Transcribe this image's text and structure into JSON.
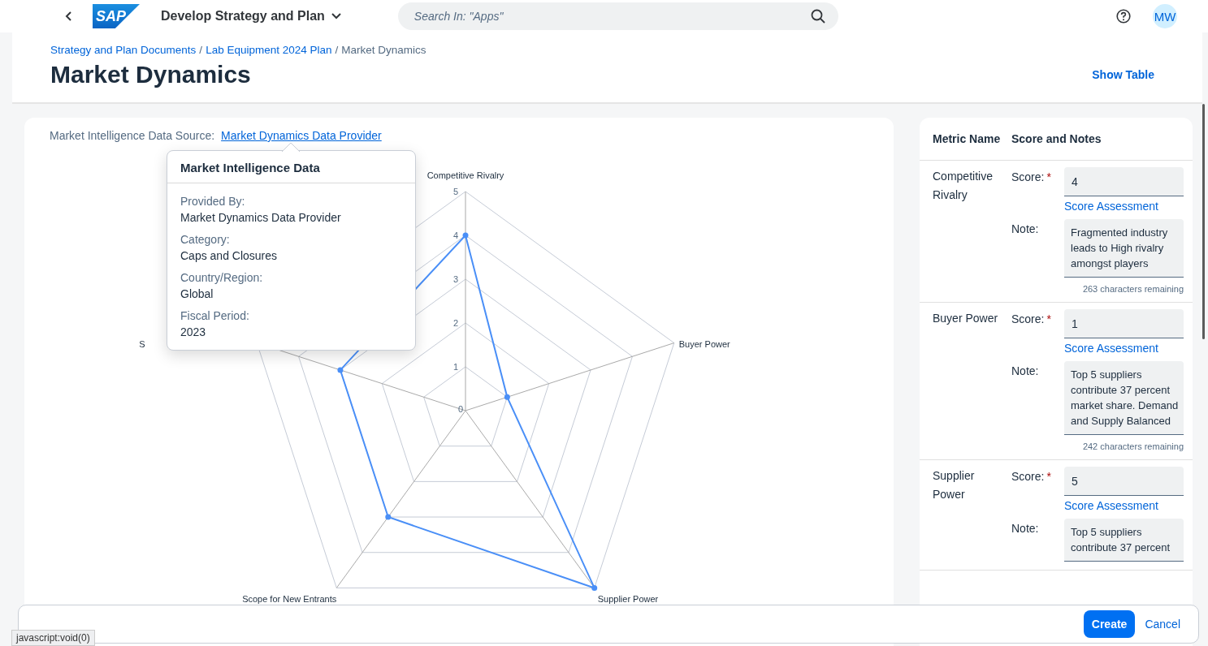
{
  "shell": {
    "logo": "SAP",
    "app_title": "Develop Strategy and Plan",
    "search": {
      "placeholder": "Search In: \"Apps\""
    },
    "avatar": "MW"
  },
  "breadcrumb_separator": "/",
  "breadcrumbs": [
    {
      "label": "Strategy and Plan Documents",
      "link": true
    },
    {
      "label": "Lab Equipment 2024 Plan",
      "link": true
    },
    {
      "label": "Market Dynamics",
      "link": false
    }
  ],
  "title": "Market Dynamics",
  "header_action": "Show Table",
  "source": {
    "label": "Market Intelligence Data Source:",
    "link": "Market Dynamics Data Provider"
  },
  "chart_data": {
    "type": "radar",
    "categories": [
      "Competitive Rivalry",
      "Buyer Power",
      "Supplier Power",
      "Scope for New Entrants",
      "S"
    ],
    "ylim": [
      0,
      5
    ],
    "yticks": [
      {
        "value": 0,
        "label": "0"
      },
      {
        "value": 1,
        "label": "1"
      },
      {
        "value": 2,
        "label": "2"
      },
      {
        "value": 3,
        "label": "3"
      },
      {
        "value": 4,
        "label": "4"
      },
      {
        "value": 5,
        "label": "5"
      }
    ],
    "series": [
      {
        "color": "#4a8ff7",
        "values": [
          4,
          1,
          5,
          3,
          3
        ]
      }
    ]
  },
  "popover": {
    "title": "Market Intelligence Data",
    "fields": [
      {
        "label": "Provided By:",
        "value": "Market Dynamics Data Provider"
      },
      {
        "label": "Category:",
        "value": "Caps and Closures"
      },
      {
        "label": "Country/Region:",
        "value": "Global"
      },
      {
        "label": "Fiscal Period:",
        "value": "2023"
      }
    ]
  },
  "metrics": {
    "required_marker": "*",
    "columns": [
      "Metric Name",
      "Score and Notes"
    ],
    "rows": [
      {
        "name": "Competitive Rivalry",
        "score_label": "Score:",
        "required": true,
        "score": "4",
        "link": "Score Assessment",
        "note_label": "Note:",
        "note": "Fragmented industry leads to High rivalry amongst players",
        "remaining": "263 characters remaining"
      },
      {
        "name": "Buyer Power",
        "score_label": "Score:",
        "required": true,
        "score": "1",
        "link": "Score Assessment",
        "note_label": "Note:",
        "note": "Top 5 suppliers contribute 37 percent market share. Demand and Supply Balanced",
        "remaining": "242 characters remaining"
      },
      {
        "name": "Supplier Power",
        "score_label": "Score:",
        "required": true,
        "score": "5",
        "link": "Score Assessment",
        "note_label": "Note:",
        "note": "Top 5 suppliers contribute 37 percent"
      }
    ]
  },
  "footer": {
    "buttons": [
      {
        "label": "Create",
        "kind": "primary"
      },
      {
        "label": "Cancel",
        "kind": "transparent"
      }
    ]
  },
  "status_bar": "javascript:void(0)"
}
